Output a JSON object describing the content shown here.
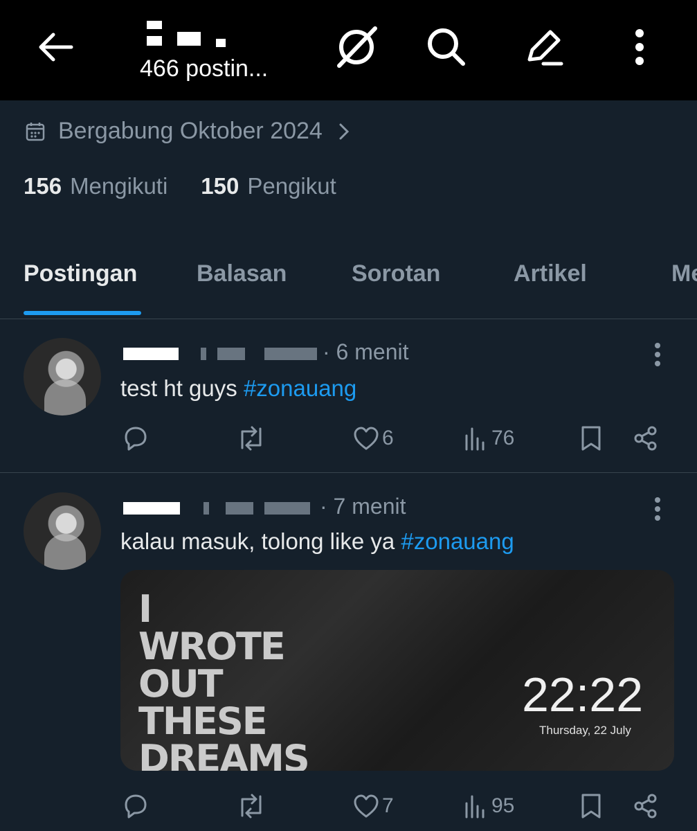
{
  "header": {
    "post_count": "466 postin..."
  },
  "profile": {
    "joined": "Bergabung Oktober 2024",
    "following_count": "156",
    "following_label": "Mengikuti",
    "followers_count": "150",
    "followers_label": "Pengikut"
  },
  "tabs": [
    {
      "label": "Postingan"
    },
    {
      "label": "Balasan"
    },
    {
      "label": "Sorotan"
    },
    {
      "label": "Artikel"
    },
    {
      "label": "Me"
    }
  ],
  "posts": [
    {
      "time": "· 6 menit",
      "text": "test ht guys ",
      "hashtag": "#zonauang",
      "likes": "6",
      "views": "76"
    },
    {
      "time": "· 7 menit",
      "text": "kalau masuk, tolong like ya ",
      "hashtag": "#zonauang",
      "media": {
        "lines": [
          "I",
          "WROTE",
          "OUT",
          "THESE",
          "DREAMS"
        ],
        "clock": "22:22",
        "date": "Thursday, 22 July"
      },
      "likes": "7",
      "views": "95"
    }
  ],
  "colors": {
    "background": "#15202b",
    "accent": "#1d9bf0",
    "muted": "#8b98a5"
  }
}
